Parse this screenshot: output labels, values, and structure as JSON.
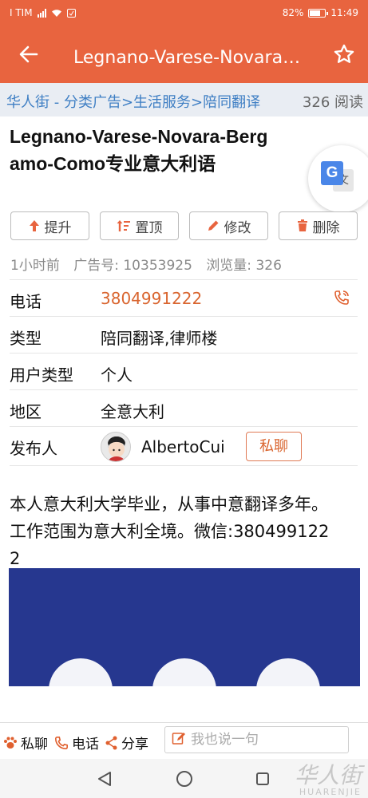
{
  "status_bar": {
    "carrier": "I TIM",
    "battery": "82%",
    "time": "11:49"
  },
  "app_bar": {
    "title": "Legnano-Varese-Novara-Bergamo-Como专业意大利语",
    "back_icon": "arrow-left-icon",
    "favorite_icon": "star-outline-icon"
  },
  "breadcrumb": {
    "path": "华人街 - 分类广告>生活服务>陪同翻译",
    "reads": "326 阅读"
  },
  "post": {
    "title": "Legnano-Varese-Novara-Bergamo-Como专业意大利语",
    "actions": {
      "promote": "提升",
      "pin": "置顶",
      "edit": "修改",
      "delete": "删除"
    },
    "meta": {
      "posted": "1小时前",
      "ad_number": "广告号: 10353925",
      "views": "浏览量: 326"
    },
    "fields": [
      {
        "label": "电话",
        "value": "3804991222"
      },
      {
        "label": "类型",
        "value": "陪同翻译,律师楼"
      },
      {
        "label": "用户类型",
        "value": "个人"
      },
      {
        "label": "地区",
        "value": "全意大利"
      },
      {
        "label": "发布人",
        "value": "AlbertoCui"
      }
    ],
    "chat_button": "私聊",
    "description": "本人意大利大学毕业，从事中意翻译多年。工作范围为意大利全境。微信:3804991222"
  },
  "bottom_bar": {
    "chat": "私聊",
    "phone": "电话",
    "share": "分享",
    "comment_placeholder": "我也说一句"
  },
  "watermark": {
    "cn": "华人街",
    "en": "HUARENJIE"
  },
  "colors": {
    "primary": "#e8643f",
    "link": "#3f7fc4",
    "image_bg": "#26378f"
  }
}
